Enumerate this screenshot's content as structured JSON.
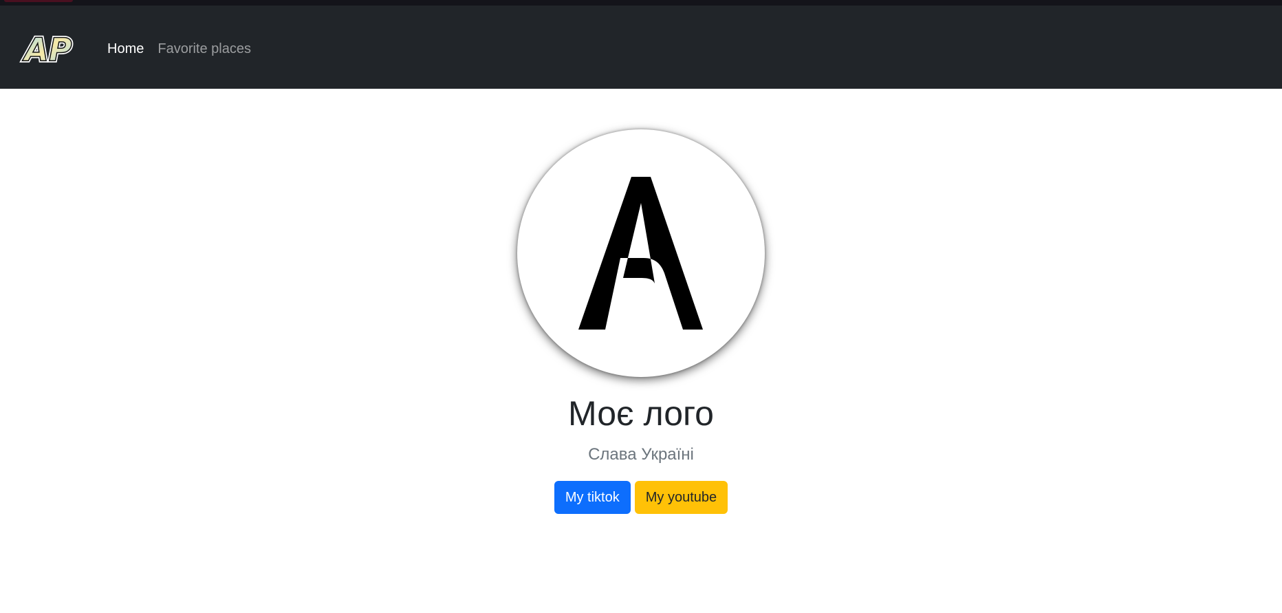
{
  "navbar": {
    "brand_text": "AP",
    "links": [
      {
        "label": "Home",
        "active": true
      },
      {
        "label": "Favorite places",
        "active": false
      }
    ]
  },
  "hero": {
    "logo_letter": "A",
    "title": "Моє лого",
    "subtitle": "Слава Україні",
    "buttons": [
      {
        "label": "My tiktok",
        "style": "primary",
        "color": "#0d6efd"
      },
      {
        "label": "My youtube",
        "style": "warning",
        "color": "#ffc107"
      }
    ]
  },
  "colors": {
    "navbar_bg": "#212529",
    "top_strip": "#14141a"
  }
}
